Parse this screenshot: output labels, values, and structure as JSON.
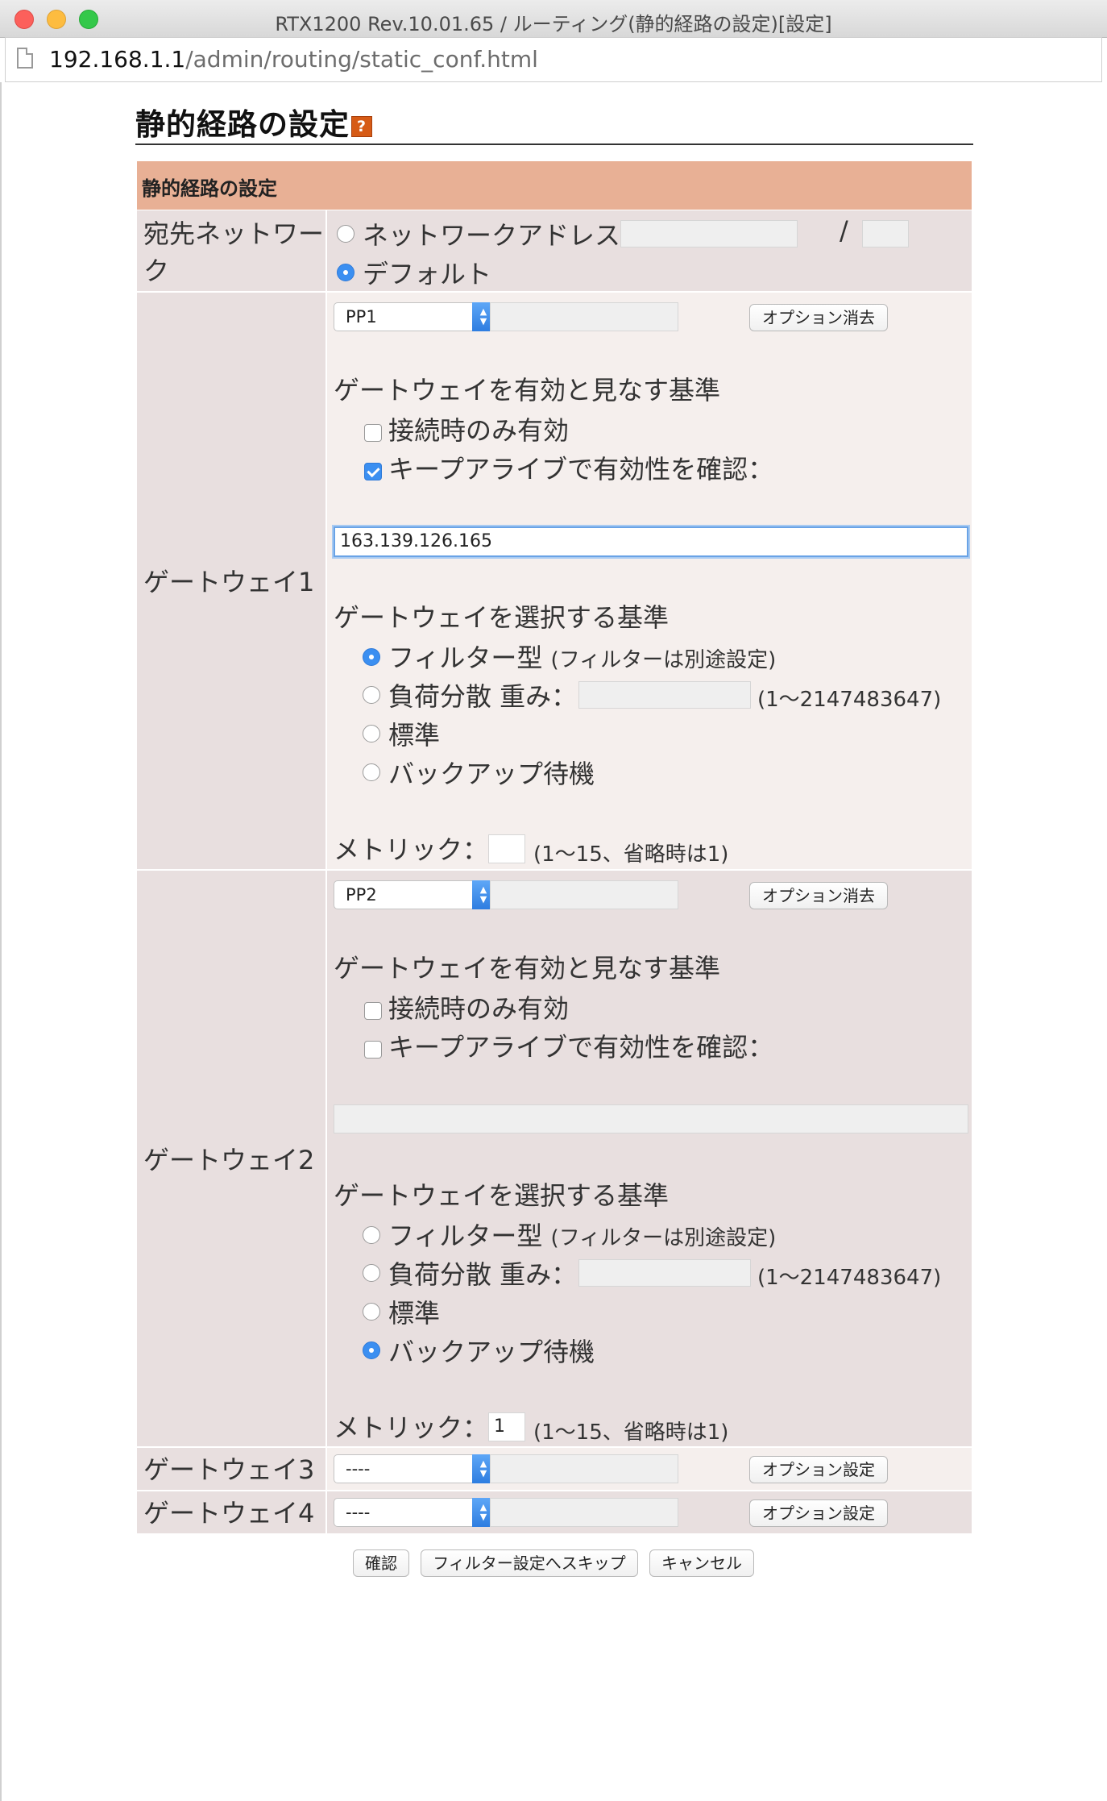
{
  "window": {
    "title": "RTX1200 Rev.10.01.65 / ルーティング(静的経路の設定)[設定]",
    "url_host": "192.168.1.1",
    "url_path": "/admin/routing/static_conf.html"
  },
  "page": {
    "title": "静的経路の設定",
    "help_icon": "?",
    "section_header": "静的経路の設定"
  },
  "destination": {
    "label": "宛先ネットワーク",
    "network_address_label": "ネットワークアドレス",
    "network_address_value": "",
    "slash": "/",
    "prefix_value": "",
    "default_label": "デフォルト",
    "selected": "default"
  },
  "gateway1": {
    "label": "ゲートウェイ1",
    "interface": "PP1",
    "interface_detail": "",
    "option_button": "オプション消去",
    "validity_heading": "ゲートウェイを有効と見なす基準",
    "connect_only_label": "接続時のみ有効",
    "connect_only_checked": false,
    "keepalive_label": "キープアライブで有効性を確認：",
    "keepalive_checked": true,
    "keepalive_host": "163.139.126.165",
    "select_heading": "ゲートウェイを選択する基準",
    "filter_label": "フィルター型",
    "filter_note": "(フィルターは別途設定)",
    "loadbalance_label": "負荷分散 重み：",
    "weight_value": "",
    "weight_range": "(1〜2147483647)",
    "standard_label": "標準",
    "backup_label": "バックアップ待機",
    "selection": "filter",
    "metric_label": "メトリック：",
    "metric_value": "",
    "metric_note": "(1〜15、省略時は1)"
  },
  "gateway2": {
    "label": "ゲートウェイ2",
    "interface": "PP2",
    "interface_detail": "",
    "option_button": "オプション消去",
    "validity_heading": "ゲートウェイを有効と見なす基準",
    "connect_only_label": "接続時のみ有効",
    "connect_only_checked": false,
    "keepalive_label": "キープアライブで有効性を確認：",
    "keepalive_checked": false,
    "keepalive_host": "",
    "select_heading": "ゲートウェイを選択する基準",
    "filter_label": "フィルター型",
    "filter_note": "(フィルターは別途設定)",
    "loadbalance_label": "負荷分散 重み：",
    "weight_value": "",
    "weight_range": "(1〜2147483647)",
    "standard_label": "標準",
    "backup_label": "バックアップ待機",
    "selection": "backup",
    "metric_label": "メトリック：",
    "metric_value": "1",
    "metric_note": "(1〜15、省略時は1)"
  },
  "gateway3": {
    "label": "ゲートウェイ3",
    "interface": "----",
    "interface_detail": "",
    "option_button": "オプション設定"
  },
  "gateway4": {
    "label": "ゲートウェイ4",
    "interface": "----",
    "interface_detail": "",
    "option_button": "オプション設定"
  },
  "actions": {
    "confirm": "確認",
    "skip_filter": "フィルター設定へスキップ",
    "cancel": "キャンセル"
  },
  "icons": {
    "page": "document-icon",
    "help": "help-icon",
    "select_arrow": "updown-arrows-icon"
  },
  "colors": {
    "section_header": "#e8b095",
    "row_dark": "#e8dfdf",
    "row_light": "#f5efed",
    "accent": "#3b8ff1",
    "help_icon": "#d65b16"
  }
}
